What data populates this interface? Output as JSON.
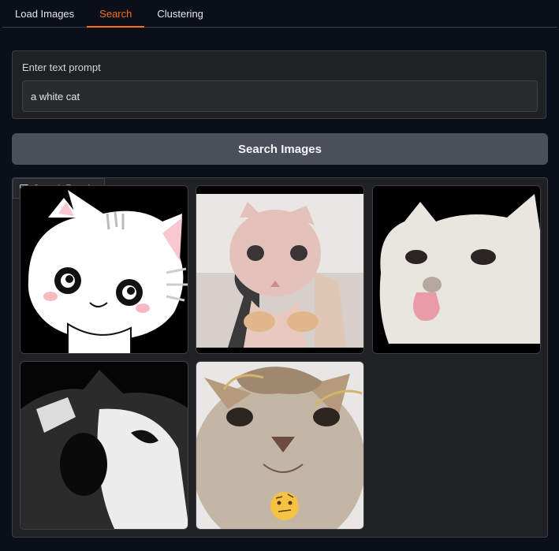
{
  "tabs": [
    {
      "label": "Load Images"
    },
    {
      "label": "Search"
    },
    {
      "label": "Clustering"
    }
  ],
  "active_tab": "Search",
  "prompt": {
    "label": "Enter text prompt",
    "value": "a white cat"
  },
  "search_button": {
    "label": "Search Images"
  },
  "gallery": {
    "label": "Search Results",
    "label_icon": "image-icon",
    "result_count": 5
  },
  "colors": {
    "accent": "#f97316",
    "background": "#0b0f19",
    "panel": "#202123",
    "button": "#4b4f5a"
  }
}
